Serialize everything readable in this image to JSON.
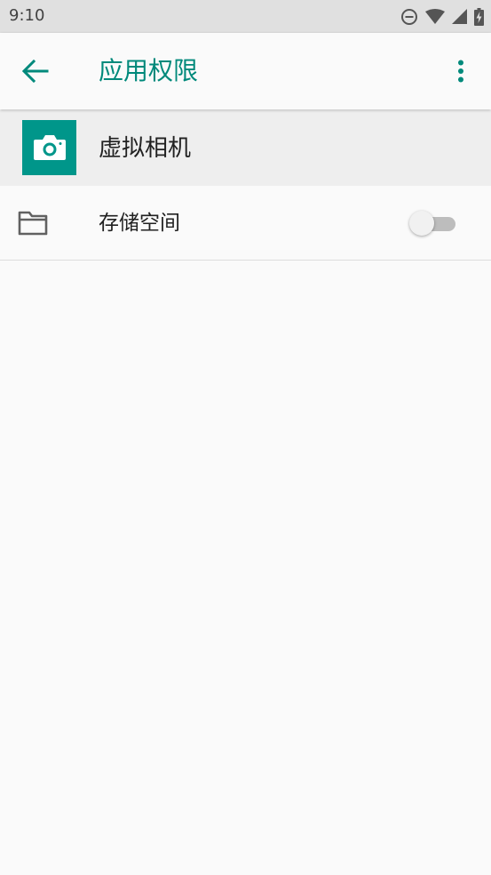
{
  "status_bar": {
    "time": "9:10",
    "icons": [
      "do-not-disturb-icon",
      "wifi-icon",
      "cellular-signal-icon",
      "battery-charging-icon"
    ]
  },
  "app_bar": {
    "title": "应用权限",
    "back_icon": "arrow-back-icon",
    "more_icon": "more-vert-icon"
  },
  "app_header": {
    "name": "虚拟相机",
    "icon": "camera-icon",
    "icon_bg_color": "#00968a"
  },
  "permissions": [
    {
      "label": "存储空间",
      "icon": "folder-icon",
      "enabled": false
    }
  ],
  "colors": {
    "accent": "#00897b",
    "status_bar_bg": "#e0e0e0",
    "background": "#fafafa"
  }
}
